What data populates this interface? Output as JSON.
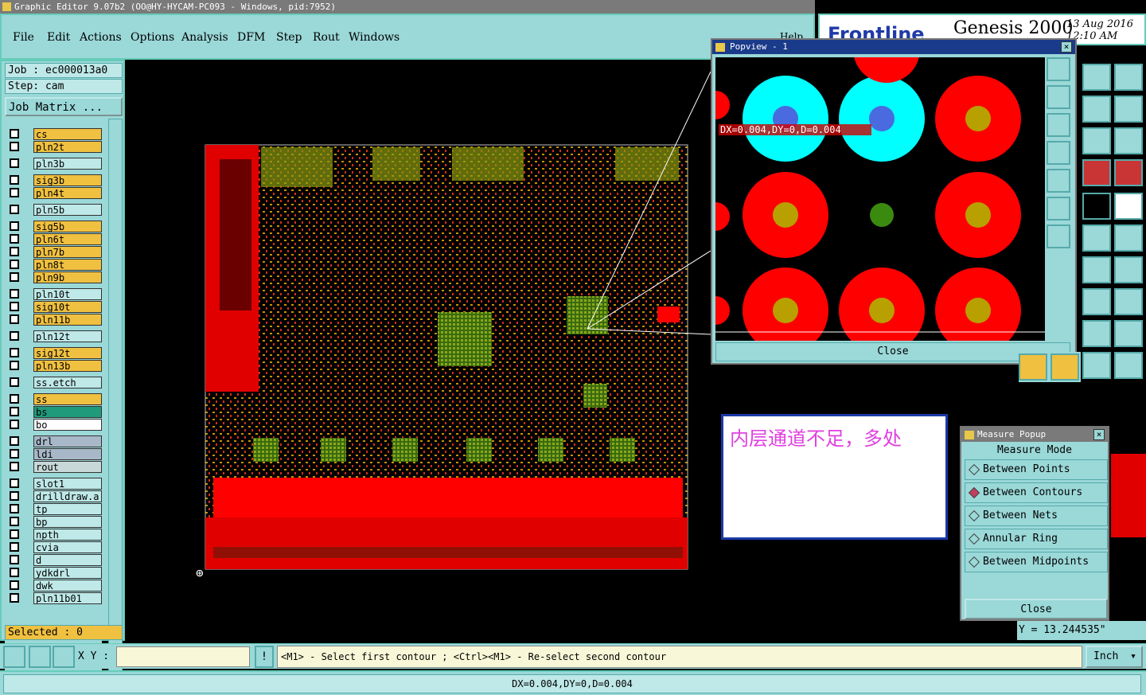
{
  "window": {
    "title": "Graphic Editor 9.07b2 (OO@HY-HYCAM-PC093 - Windows, pid:7952)"
  },
  "menu": {
    "items": [
      "File",
      "Edit",
      "Actions",
      "Options",
      "Analysis",
      "DFM",
      "Step",
      "Rout",
      "Windows"
    ],
    "help": "Help"
  },
  "brand": {
    "logo": "Frontline",
    "product": "Genesis 2000",
    "date": "13 Aug 2016",
    "time": "12:10 AM"
  },
  "job": {
    "job_label": "Job : ec000013a0",
    "step_label": "Step: cam",
    "matrix_button": "Job Matrix ..."
  },
  "layers": [
    {
      "name": "cs",
      "color": "#f0c040"
    },
    {
      "name": "pln2t",
      "color": "#f0c040"
    },
    {
      "name": "pln3b",
      "color": "#bfe8e8"
    },
    {
      "name": "sig3b",
      "color": "#f0c040"
    },
    {
      "name": "pln4t",
      "color": "#f0c040"
    },
    {
      "name": "pln5b",
      "color": "#bfe8e8"
    },
    {
      "name": "sig5b",
      "color": "#f0c040"
    },
    {
      "name": "pln6t",
      "color": "#f0c040"
    },
    {
      "name": "pln7b",
      "color": "#f0c040"
    },
    {
      "name": "pln8t",
      "color": "#f0c040"
    },
    {
      "name": "pln9b",
      "color": "#f0c040"
    },
    {
      "name": "pln10t",
      "color": "#bfe8e8"
    },
    {
      "name": "sig10t",
      "color": "#f0c040"
    },
    {
      "name": "pln11b",
      "color": "#f0c040"
    },
    {
      "name": "pln12t",
      "color": "#bfe8e8"
    },
    {
      "name": "sig12t",
      "color": "#f0c040"
    },
    {
      "name": "pln13b",
      "color": "#f0c040"
    },
    {
      "name": "ss.etch",
      "color": "#bfe8e8"
    },
    {
      "name": "ss",
      "color": "#f0c040"
    },
    {
      "name": "bs",
      "color": "#1f9a7a"
    },
    {
      "name": "bo",
      "color": "#ffffff"
    },
    {
      "name": "drl",
      "color": "#a8b8c8"
    },
    {
      "name": "ldi",
      "color": "#a8b8c8"
    },
    {
      "name": "rout",
      "color": "#c8d8d8"
    },
    {
      "name": "slot1",
      "color": "#bfe8e8"
    },
    {
      "name": "drilldraw.a",
      "color": "#bfe8e8"
    },
    {
      "name": "tp",
      "color": "#bfe8e8"
    },
    {
      "name": "bp",
      "color": "#bfe8e8"
    },
    {
      "name": "npth",
      "color": "#bfe8e8"
    },
    {
      "name": "cvia",
      "color": "#bfe8e8"
    },
    {
      "name": "d",
      "color": "#bfe8e8"
    },
    {
      "name": "ydkdrl",
      "color": "#bfe8e8"
    },
    {
      "name": "dwk",
      "color": "#bfe8e8"
    },
    {
      "name": "pln11b01",
      "color": "#bfe8e8"
    }
  ],
  "selected": "Selected : 0",
  "popview": {
    "title": "Popview - 1",
    "measure_label": "DX=0.004,DY=0,D=0.004",
    "close": "Close"
  },
  "note": {
    "text": "内层通道不足，多处"
  },
  "measure_popup": {
    "title": "Measure Popup",
    "header": "Measure Mode",
    "options": [
      "Between Points",
      "Between Contours",
      "Between Nets",
      "Annular Ring",
      "Between Midpoints"
    ],
    "selected_option": "Between Contours",
    "close": "Close"
  },
  "coord": {
    "y": "Y = 13.244535\""
  },
  "statusbar": {
    "xy_label": "X Y :",
    "xy_value": "",
    "hint": "<M1> - Select first contour ; <Ctrl><M1> - Re-select second contour",
    "units": "Inch",
    "result": "DX=0.004,DY=0,D=0.004"
  },
  "colors": {
    "panel": "#9bd8d8",
    "copper": "#ff0000",
    "pad_cyan": "#00ffff",
    "pad_dot": "#b8a000"
  }
}
